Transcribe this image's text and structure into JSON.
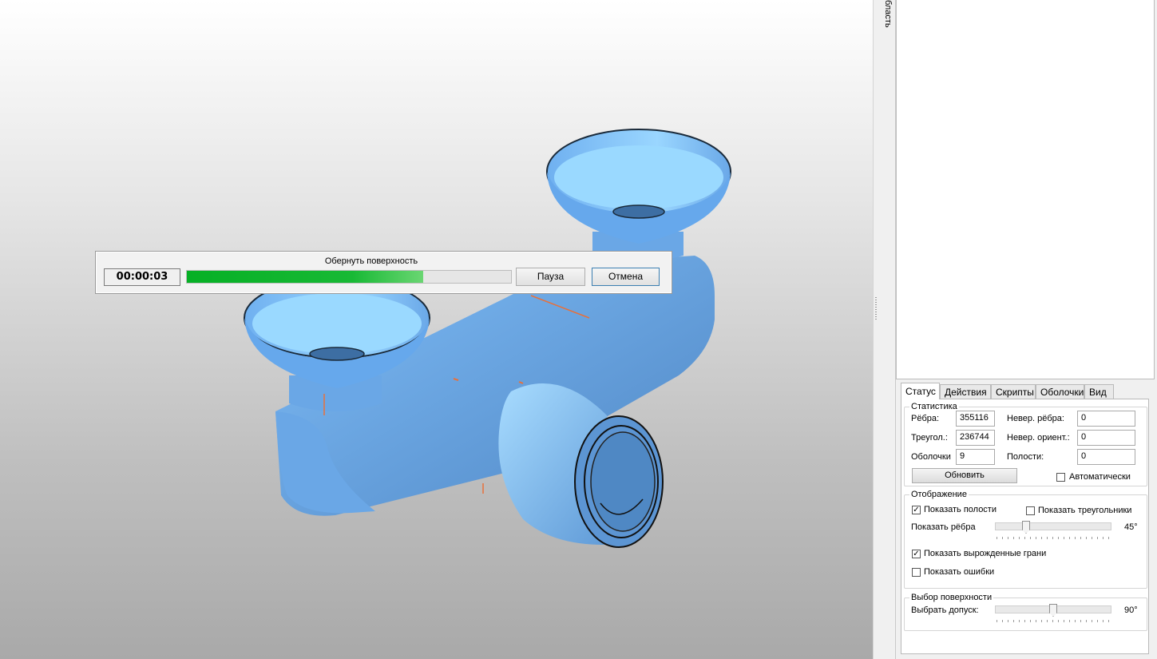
{
  "progress": {
    "title": "Обернуть поверхность",
    "elapsed": "00:00:03",
    "fraction": 0.73,
    "pause_label": "Пауза",
    "cancel_label": "Отмена"
  },
  "side_strip": {
    "label": "бласть"
  },
  "tabs": [
    "Статус",
    "Действия",
    "Скрипты",
    "Оболочки",
    "Вид"
  ],
  "statistics": {
    "group": "Статистика",
    "edges_label": "Рёбра:",
    "edges": "355116",
    "triangles_label": "Треугол.:",
    "triangles": "236744",
    "shells_label": "Оболочки",
    "shells": "9",
    "bad_edges_label": "Невер. рёбра:",
    "bad_edges": "0",
    "bad_orient_label": "Невер. ориент.:",
    "bad_orient": "0",
    "holes_label": "Полости:",
    "holes": "0",
    "refresh_label": "Обновить",
    "auto_label": "Автоматически",
    "auto_checked": false
  },
  "display": {
    "group": "Отображение",
    "show_holes_label": "Показать полости",
    "show_holes": true,
    "show_triangles_label": "Показать треугольники",
    "show_triangles": false,
    "show_edges_label": "Показать рёбра",
    "edges_angle": "45°",
    "edges_angle_value": 45,
    "show_degenerate_label": "Показать вырожденные грани",
    "show_degenerate": true,
    "show_errors_label": "Показать ошибки",
    "show_errors": false
  },
  "surface": {
    "group": "Выбор поверхности",
    "tolerance_label": "Выбрать допуск:",
    "tolerance": "90°",
    "tolerance_value": 90
  },
  "colors": {
    "model": "#6fb0f0",
    "progress": "#06b025",
    "viewport_top": "#ffffff",
    "viewport_bottom": "#a9a9a9"
  }
}
